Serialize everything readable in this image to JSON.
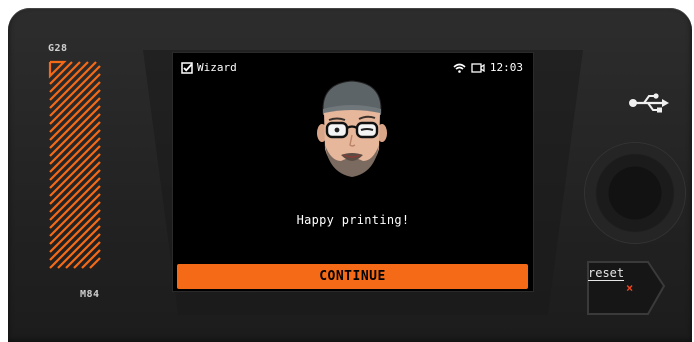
{
  "device": {
    "left_label_top": "G28",
    "left_label_bottom": "M84",
    "reset_label": "reset",
    "reset_icon": "×",
    "accent_color": "#f46a17"
  },
  "screen": {
    "status_bar": {
      "title": "Wizard",
      "time": "12:03"
    },
    "message": "Happy printing!",
    "continue_label": "CONTINUE"
  },
  "icons": [
    "checkbox-icon",
    "wifi-icon",
    "camera-icon",
    "usb-icon",
    "avatar-illustration",
    "zigzag-pattern",
    "rotary-knob"
  ]
}
